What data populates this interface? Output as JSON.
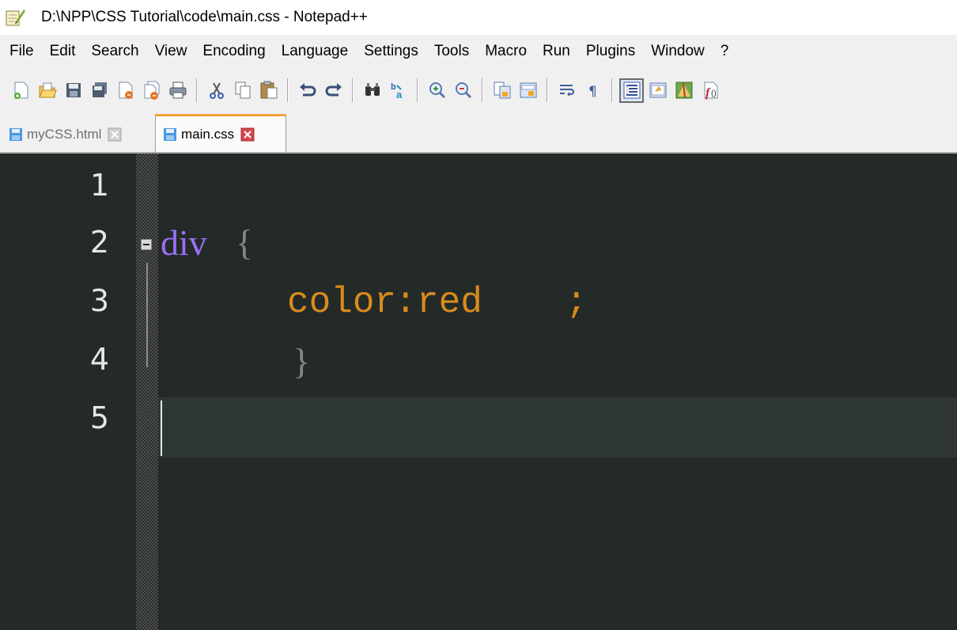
{
  "window": {
    "title": "D:\\NPP\\CSS Tutorial\\code\\main.css - Notepad++"
  },
  "menu": [
    "File",
    "Edit",
    "Search",
    "View",
    "Encoding",
    "Language",
    "Settings",
    "Tools",
    "Macro",
    "Run",
    "Plugins",
    "Window",
    "?"
  ],
  "toolbar": {
    "icons": [
      "new-file-icon",
      "open-file-icon",
      "save-icon",
      "save-all-icon",
      "close-icon",
      "close-all-icon",
      "print-icon",
      "cut-icon",
      "copy-icon",
      "paste-icon",
      "undo-icon",
      "redo-icon",
      "find-icon",
      "replace-icon",
      "zoom-in-icon",
      "zoom-out-icon",
      "sync-vertical-icon",
      "sync-horizontal-icon",
      "word-wrap-icon",
      "show-all-chars-icon",
      "indent-guide-icon",
      "user-defined-lang-icon",
      "doc-map-icon",
      "function-list-icon"
    ]
  },
  "tabs": [
    {
      "label": "myCSS.html",
      "active": false
    },
    {
      "label": "main.css",
      "active": true
    }
  ],
  "editor": {
    "line_numbers": [
      "1",
      "2",
      "3",
      "4",
      "5"
    ],
    "lines": [
      {
        "n": 2,
        "selector": "div",
        "brace": "{"
      },
      {
        "n": 3,
        "property": "color",
        "colon": ":",
        "value": "red",
        "semicolon": ";"
      },
      {
        "n": 4,
        "brace": "}"
      }
    ],
    "current_line": 5,
    "colors": {
      "background": "#232a27",
      "selector": "#9a6ff5",
      "brace": "#7e8a83",
      "property": "#d98a1c",
      "line_number": "#e6e6e6"
    }
  }
}
